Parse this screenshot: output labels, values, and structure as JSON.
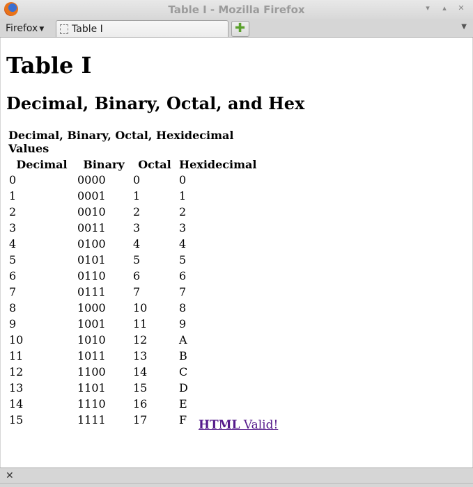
{
  "window": {
    "title": "Table I - Mozilla Firefox",
    "min_glyph": "▾",
    "max_glyph": "▴",
    "close_glyph": "✕"
  },
  "toolbar": {
    "menu_label": "Firefox",
    "menu_arrow": "▼",
    "tab_title": "Table I",
    "new_tab_glyph": "✚",
    "tab_list_arrow": "▼"
  },
  "page": {
    "heading": "Table I",
    "subheading": "Decimal, Binary, Octal, and Hex",
    "table": {
      "caption": "Decimal, Binary, Octal, Hexidecimal Values",
      "headers": [
        "Decimal",
        "Binary",
        "Octal",
        "Hexidecimal"
      ],
      "rows": [
        [
          "0",
          "0000",
          "0",
          "0"
        ],
        [
          "1",
          "0001",
          "1",
          "1"
        ],
        [
          "2",
          "0010",
          "2",
          "2"
        ],
        [
          "3",
          "0011",
          "3",
          "3"
        ],
        [
          "4",
          "0100",
          "4",
          "4"
        ],
        [
          "5",
          "0101",
          "5",
          "5"
        ],
        [
          "6",
          "0110",
          "6",
          "6"
        ],
        [
          "7",
          "0111",
          "7",
          "7"
        ],
        [
          "8",
          "1000",
          "10",
          "8"
        ],
        [
          "9",
          "1001",
          "11",
          "9"
        ],
        [
          "10",
          "1010",
          "12",
          "A"
        ],
        [
          "11",
          "1011",
          "13",
          "B"
        ],
        [
          "12",
          "1100",
          "14",
          "C"
        ],
        [
          "13",
          "1101",
          "15",
          "D"
        ],
        [
          "14",
          "1110",
          "16",
          "E"
        ],
        [
          "15",
          "1111",
          "17",
          "F"
        ]
      ]
    },
    "validator": {
      "strong": "HTML",
      "rest": " Valid!"
    }
  },
  "statusbar": {
    "close_glyph": "✕"
  },
  "colors": {
    "link_visited": "#551a8b",
    "chrome": "#d6d6d6",
    "page_bg": "#ffffff"
  }
}
